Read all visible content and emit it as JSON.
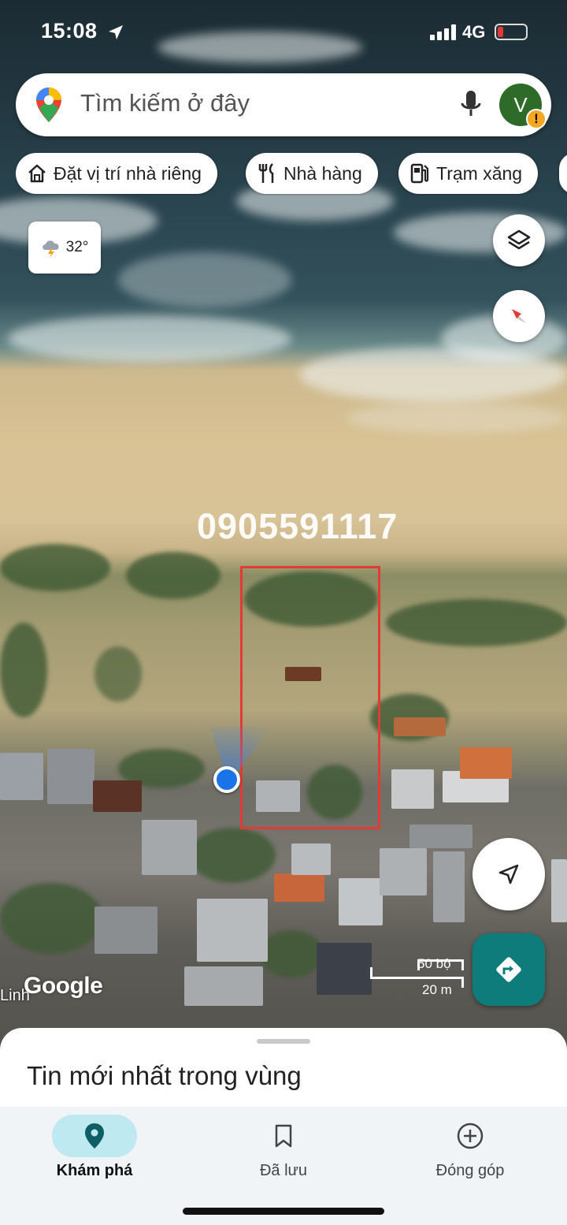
{
  "status_bar": {
    "time": "15:08",
    "network": "4G"
  },
  "search": {
    "placeholder": "Tìm kiếm ở đây",
    "avatar_letter": "V",
    "alert": "!"
  },
  "chips": [
    {
      "icon": "home-icon",
      "label": "Đặt vị trí nhà riêng"
    },
    {
      "icon": "restaurant-icon",
      "label": "Nhà hàng"
    },
    {
      "icon": "gas-station-icon",
      "label": "Trạm xăng"
    }
  ],
  "weather": {
    "temperature": "32°",
    "icon": "thunderstorm-icon"
  },
  "map": {
    "overlay_phone": "0905591117",
    "scale": {
      "imperial": "50 bộ",
      "metric": "20 m"
    },
    "attribution": "Google",
    "place_label_fragment": "Linh"
  },
  "bottom_sheet": {
    "title": "Tin mới nhất trong vùng"
  },
  "nav": [
    {
      "label": "Khám phá",
      "icon": "location-pin-icon",
      "active": true
    },
    {
      "label": "Đã lưu",
      "icon": "bookmark-icon",
      "active": false
    },
    {
      "label": "Đóng góp",
      "icon": "add-circle-icon",
      "active": false
    }
  ],
  "colors": {
    "accent": "#1a73e8",
    "parcel_outline": "#e53a33",
    "directions": "#0f7c7c",
    "active_pill": "#bfe9f0"
  }
}
